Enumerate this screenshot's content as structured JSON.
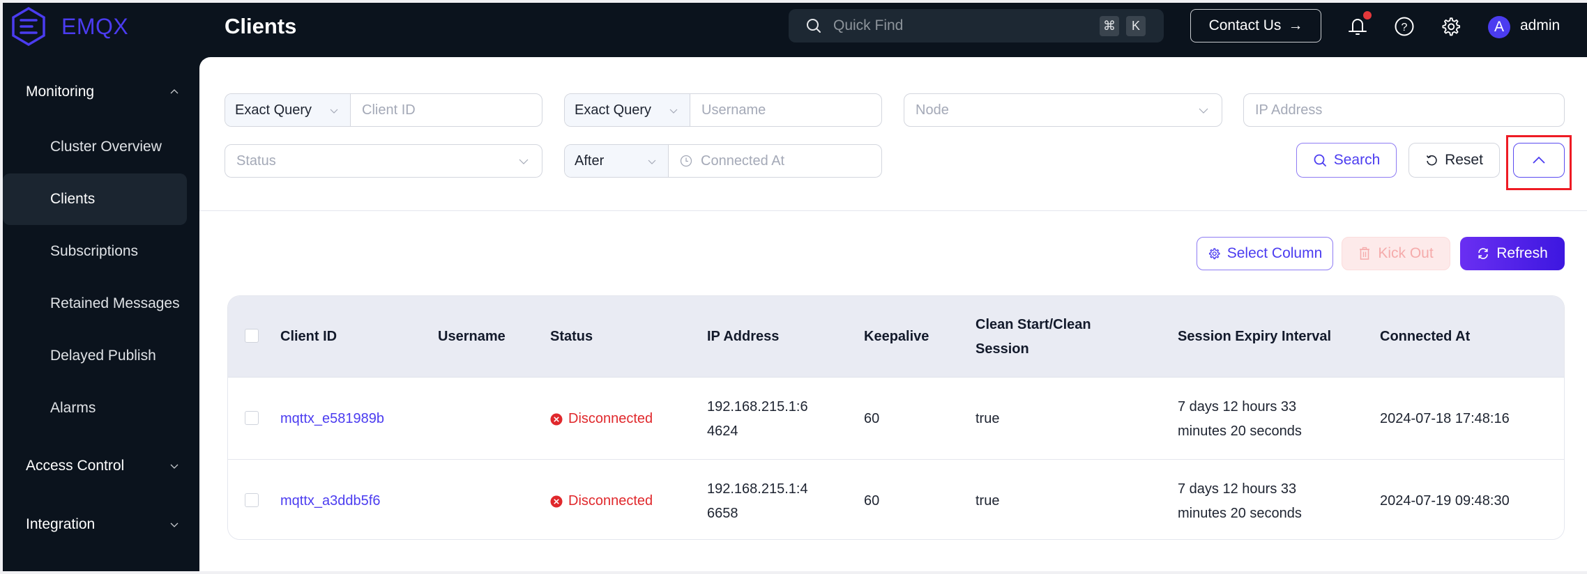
{
  "app": {
    "brand": "EMQX",
    "page_title": "Clients"
  },
  "header": {
    "quick_find_placeholder": "Quick Find",
    "shortcut_keys": [
      "⌘",
      "K"
    ],
    "contact_label": "Contact Us",
    "contact_arrow": "→",
    "notification_badge": true,
    "user": {
      "avatar_initial": "A",
      "name": "admin"
    }
  },
  "sidebar": {
    "groups": [
      {
        "label": "Monitoring",
        "expanded": true,
        "items": [
          {
            "label": "Cluster Overview",
            "active": false
          },
          {
            "label": "Clients",
            "active": true
          },
          {
            "label": "Subscriptions",
            "active": false
          },
          {
            "label": "Retained Messages",
            "active": false
          },
          {
            "label": "Delayed Publish",
            "active": false
          },
          {
            "label": "Alarms",
            "active": false
          }
        ]
      },
      {
        "label": "Access Control",
        "expanded": false
      },
      {
        "label": "Integration",
        "expanded": false
      }
    ]
  },
  "filters": {
    "client_id": {
      "mode": "Exact Query",
      "placeholder": "Client ID",
      "value": ""
    },
    "username": {
      "mode": "Exact Query",
      "placeholder": "Username",
      "value": ""
    },
    "node": {
      "placeholder": "Node",
      "value": ""
    },
    "ip_address": {
      "placeholder": "IP Address",
      "value": ""
    },
    "status": {
      "placeholder": "Status",
      "value": ""
    },
    "connected_at": {
      "mode": "After",
      "placeholder": "Connected At",
      "value": ""
    },
    "search_label": "Search",
    "reset_label": "Reset",
    "collapse_expanded": true
  },
  "toolbar": {
    "select_column_label": "Select Column",
    "kick_out_label": "Kick Out",
    "kick_out_disabled": true,
    "refresh_label": "Refresh"
  },
  "table": {
    "columns": [
      "Client ID",
      "Username",
      "Status",
      "IP Address",
      "Keepalive",
      "Clean Start/Clean Session",
      "Session Expiry Interval",
      "Connected At"
    ],
    "rows": [
      {
        "client_id": "mqttx_e581989b",
        "username": "",
        "status": "Disconnected",
        "ip_address": "192.168.215.1:64624",
        "keepalive": "60",
        "clean_start": "true",
        "session_expiry": "7 days 12 hours 33 minutes 20 seconds",
        "connected_at": "2024-07-18 17:48:16"
      },
      {
        "client_id": "mqttx_a3ddb5f6",
        "username": "",
        "status": "Disconnected",
        "ip_address": "192.168.215.1:46658",
        "keepalive": "60",
        "clean_start": "true",
        "session_expiry": "7 days 12 hours 33 minutes 20 seconds",
        "connected_at": "2024-07-19 09:48:30"
      }
    ]
  },
  "colors": {
    "brand": "#4b3cf0",
    "header_bg": "#0b131d",
    "status_disconnected": "#e0282c",
    "highlight": "#ee1b24"
  }
}
